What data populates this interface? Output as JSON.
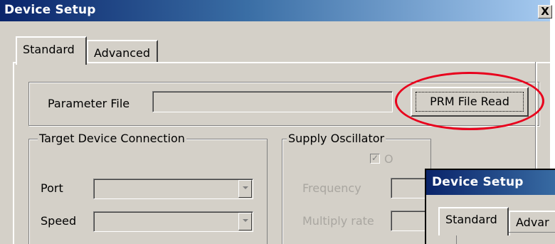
{
  "main_window": {
    "title": "Device Setup",
    "close_label": "X",
    "tabs": [
      "Standard",
      "Advanced"
    ],
    "active_tab": "Standard",
    "parameter_file": {
      "label": "Parameter File",
      "value": "",
      "button_label": "PRM File Read"
    },
    "target_device_connection": {
      "group_label": "Target Device Connection",
      "port_label": "Port",
      "port_value": "",
      "speed_label": "Speed",
      "speed_value": ""
    },
    "supply_oscillator": {
      "group_label": "Supply Oscillator",
      "checkbox_label": "O",
      "checkbox_checked": true,
      "frequency_label": "Frequency",
      "frequency_value": "",
      "multiply_label": "Multiply rate",
      "multiply_value": ""
    }
  },
  "overlay_window": {
    "title": "Device Setup",
    "tabs": [
      "Standard",
      "Advar"
    ]
  },
  "colors": {
    "face": "#d4d0c8",
    "title_start": "#0a246a",
    "title_end": "#a6caf0",
    "annotation": "#e8001c"
  }
}
